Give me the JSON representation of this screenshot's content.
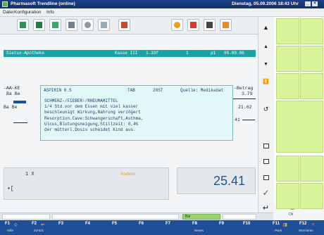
{
  "window": {
    "title": "Pharmasoft Trendline (online)",
    "datetime": "Dienstag, 05.09.2006  18:43 Uhr"
  },
  "menu": [
    "Datei",
    "Konfiguration",
    "Info"
  ],
  "toolbar": {
    "icons": [
      "pharmacy-card-icon",
      "customer-icon",
      "doctor-icon",
      "register-icon",
      "settings-icon",
      "window-icon",
      "exit-icon",
      "gear-icon",
      "cross-icon",
      "camera-icon",
      "arrow-left-icon"
    ]
  },
  "receipt": {
    "header": {
      "pharmacy": "Sietux-Apotheke",
      "register": "Kasse III",
      "code": "1.33f",
      "user": "1",
      "slot": "p1",
      "date": "05.09.06"
    },
    "rows": {
      "r1": "-AA-KE",
      "r2": "Ba Be",
      "r3": "Ba Be",
      "betrag_label": "-Betrag",
      "v1": "3.79",
      "v2": "21.62",
      "v3": "41"
    }
  },
  "popup": {
    "name": "ASPIRIN 0.5",
    "form": "TAB",
    "qty": "20ST",
    "source": "Quelle: Medikadat",
    "warning": "SCHMERZ-/FIEBER-/RHEUMAMITTEL\n1/4 Std.vor dem Essen mit viel kasser\nbeschleunigt Wirkung,Nahrung verzögert\nResorption.Cave:Schwangerschaft,Asthma,\nUlcus,Blutungsneigung,Stillzeit: 0,4%\nder mütterl.Dosis scheidet Kind aus."
  },
  "entry": {
    "quantity": "1 X",
    "change_label": "Ändern",
    "input": "▪["
  },
  "total": "25.41",
  "status": {
    "bar": "Bar"
  },
  "right_panel": {
    "ok_label": "Ok"
  },
  "fkeys": [
    {
      "key": "F1",
      "label": "Hilfe"
    },
    {
      "key": "F2",
      "label": "Zurück"
    },
    {
      "key": "F3",
      "label": ""
    },
    {
      "key": "F4",
      "label": ""
    },
    {
      "key": "F5",
      "label": ""
    },
    {
      "key": "F6",
      "label": ""
    },
    {
      "key": "F7",
      "label": ""
    },
    {
      "key": "F8",
      "label": "Neues"
    },
    {
      "key": "F9",
      "label": ""
    },
    {
      "key": "F10",
      "label": ""
    },
    {
      "key": "F11",
      "label": "Pack"
    },
    {
      "key": "F12",
      "label": "Stornieren"
    }
  ]
}
